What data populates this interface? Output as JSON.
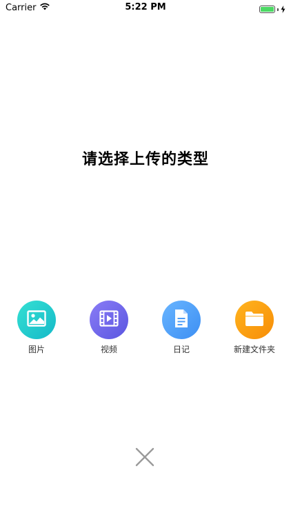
{
  "status_bar": {
    "carrier": "Carrier",
    "time": "5:22 PM",
    "battery_level": 1.0,
    "icons": [
      "wifi-icon",
      "battery-icon",
      "charging-icon"
    ]
  },
  "prompt": {
    "title": "请选择上传的类型"
  },
  "options": [
    {
      "id": "photo",
      "label": "图片",
      "icon": "image-icon",
      "color": "#1fc8cd"
    },
    {
      "id": "video",
      "label": "视频",
      "icon": "video-icon",
      "color": "#6a63ea"
    },
    {
      "id": "diary",
      "label": "日记",
      "icon": "document-icon",
      "color": "#4d9cf7"
    },
    {
      "id": "folder",
      "label": "新建文件夹",
      "icon": "folder-icon",
      "color": "#fa9d12"
    }
  ],
  "close": {
    "icon": "close-icon",
    "color": "#9a9a9a"
  }
}
